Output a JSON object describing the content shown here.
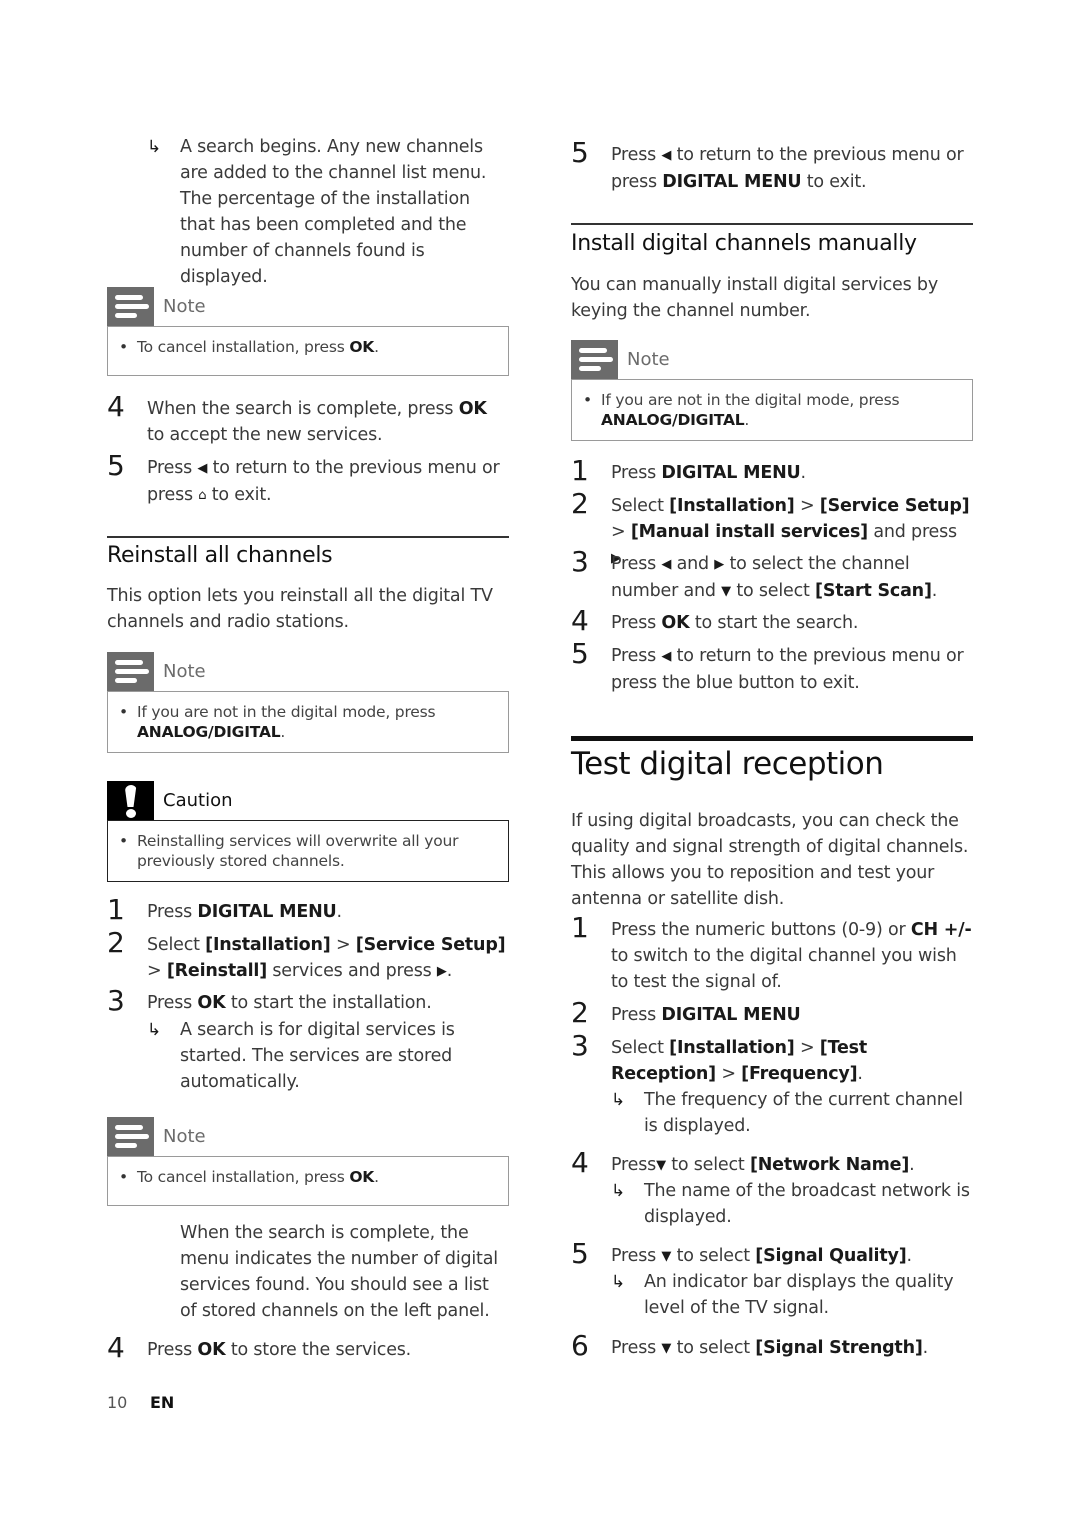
{
  "left": {
    "result_intro": "A search begins. Any new channels are added to the channel list menu. The percentage of the installation that has been completed and the number of channels found is displayed.",
    "note1": {
      "label": "Note",
      "icon": "note-icon",
      "text": "To cancel installation, press ",
      "bold": "OK",
      "end": "."
    },
    "step4": {
      "num": "4",
      "pre": "When the search is complete, press ",
      "bold": "OK",
      "post": " to accept the new services."
    },
    "step5": {
      "num": "5",
      "pre": "Press ",
      "glyph": "◀",
      "mid": " to return to the previous menu or press ",
      "glyph2": "⌂",
      "post": " to exit."
    },
    "reinstall": {
      "heading": "Reinstall all channels",
      "intro": "This option lets you reinstall all the digital TV channels and radio stations.",
      "note": {
        "label": "Note",
        "text": "If you are not in the digital mode, press ",
        "bold": "ANALOG/DIGITAL",
        "end": "."
      },
      "caution": {
        "label": "Caution",
        "icon": "exclamation-icon",
        "text": "Reinstalling services will overwrite all your previously stored channels."
      },
      "steps": [
        {
          "num": "1",
          "pre": "Press ",
          "bold": "DIGITAL MENU",
          "post": "."
        },
        {
          "num": "2",
          "pre": "Select ",
          "b1": "[Installation]",
          "sep1": " > ",
          "b2": "[Service Setup]",
          "sep2": " > ",
          "b3": "[Reinstall]",
          "post": " services and press ",
          "glyph": "▶",
          "end": "."
        },
        {
          "num": "3",
          "pre": "Press ",
          "bold": "OK",
          "post": " to start the installation."
        }
      ],
      "step3_result": "A search is for digital services is started. The services are stored automatically.",
      "note2": {
        "label": "Note",
        "text": "To cancel installation, press ",
        "bold": "OK",
        "end": "."
      },
      "after_note": "When the search is complete, the menu indicates the number of digital services found. You should see a list of stored channels on the left panel.",
      "step4": {
        "num": "4",
        "pre": "Press ",
        "bold": "OK",
        "post": " to store the services."
      }
    }
  },
  "right": {
    "step5": {
      "num": "5",
      "pre": "Press ",
      "glyph": "◀",
      "mid": " to return to the previous menu or press ",
      "bold": "DIGITAL MENU",
      "post": " to exit."
    },
    "manual": {
      "heading": "Install digital channels manually",
      "intro": "You can manually install digital services by keying the channel number.",
      "note": {
        "label": "Note",
        "text": "If you are not in the digital mode, press ",
        "bold": "ANALOG/DIGITAL",
        "end": "."
      },
      "steps": [
        {
          "num": "1",
          "pre": "Press ",
          "bold": "DIGITAL MENU",
          "post": "."
        },
        {
          "num": "2",
          "pre": "Select ",
          "b1": "[Installation]",
          "sep1": " > ",
          "b2": "[Service Setup]",
          "sep2": " > ",
          "b3": "[Manual install services]",
          "post": " and press ",
          "glyph": "▶",
          "end": "."
        },
        {
          "num": "3",
          "pre": "Press ",
          "g1": "◀",
          "mid1": " and ",
          "g2": "▶",
          "mid2": " to select the channel number and ",
          "g3": "▼",
          "mid3": " to select ",
          "bold": "[Start Scan]",
          "end": "."
        },
        {
          "num": "4",
          "pre": "Press ",
          "bold": "OK",
          "post": " to start the search."
        },
        {
          "num": "5",
          "pre": "Press ",
          "glyph": "◀",
          "post": " to return to the previous menu or press the blue button to exit."
        }
      ]
    },
    "test": {
      "heading": "Test digital reception",
      "intro": "If using digital broadcasts, you can check the quality and signal strength of digital channels. This allows you to reposition and test your antenna or satellite dish.",
      "steps": [
        {
          "num": "1",
          "pre": "Press the numeric buttons (0-9) or ",
          "bold": "CH +/-",
          "post": " to switch to the digital channel you wish to test the signal of."
        },
        {
          "num": "2",
          "pre": "Press ",
          "bold": "DIGITAL MENU",
          "post": ""
        },
        {
          "num": "3",
          "pre": "Select ",
          "b1": "[Installation]",
          "sep1": " > ",
          "b2": "[Test Reception]",
          "sep2": " > ",
          "b3": "[Frequency]",
          "end": "."
        },
        {
          "num": "4",
          "pre": "Press",
          "glyph": "▼",
          "mid": " to select ",
          "bold": "[Network Name]",
          "end": "."
        },
        {
          "num": "5",
          "pre": "Press ",
          "glyph": "▼",
          "mid": " to select ",
          "bold": "[Signal Quality]",
          "end": "."
        },
        {
          "num": "6",
          "pre": "Press ",
          "glyph": "▼",
          "mid": " to select ",
          "bold": "[Signal Strength]",
          "end": "."
        }
      ],
      "step3_result": "The frequency of the current channel is displayed.",
      "step4_result": "The name of the broadcast network is displayed.",
      "step5_result": "An indicator bar displays the quality level of the TV signal.",
      "result_arrow": "↳"
    }
  },
  "footer": {
    "page_number": "10",
    "language": "EN"
  }
}
